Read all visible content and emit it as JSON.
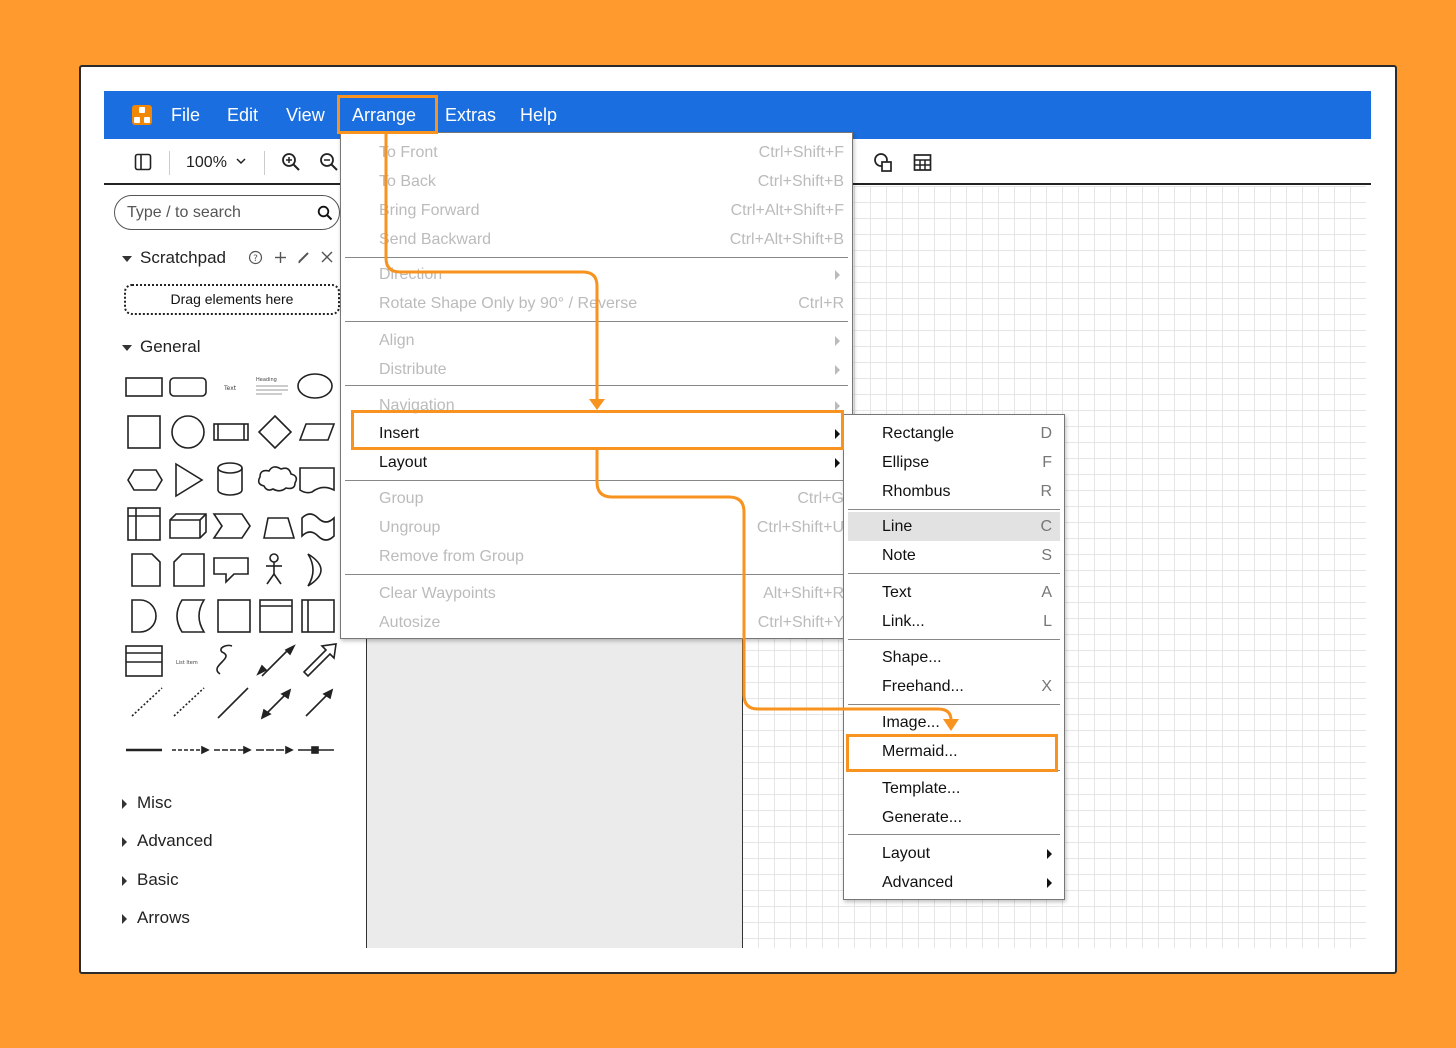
{
  "menubar": {
    "items": [
      "File",
      "Edit",
      "View",
      "Arrange",
      "Extras",
      "Help"
    ]
  },
  "toolbar": {
    "zoom": "100%"
  },
  "sidebar": {
    "search_placeholder": "Type / to search",
    "scratchpad": {
      "title": "Scratchpad",
      "dropzone": "Drag elements here"
    },
    "general": {
      "title": "General"
    },
    "collapsed_sections": [
      "Misc",
      "Advanced",
      "Basic",
      "Arrows"
    ]
  },
  "arrange_menu": {
    "items": [
      {
        "label": "To Front",
        "shortcut": "Ctrl+Shift+F"
      },
      {
        "label": "To Back",
        "shortcut": "Ctrl+Shift+B"
      },
      {
        "label": "Bring Forward",
        "shortcut": "Ctrl+Alt+Shift+F"
      },
      {
        "label": "Send Backward",
        "shortcut": "Ctrl+Alt+Shift+B"
      },
      {
        "label": "Direction",
        "shortcut": ""
      },
      {
        "label": "Rotate Shape Only by 90° / Reverse",
        "shortcut": "Ctrl+R"
      },
      {
        "label": "Align",
        "shortcut": ""
      },
      {
        "label": "Distribute",
        "shortcut": ""
      },
      {
        "label": "Navigation",
        "shortcut": ""
      },
      {
        "label": "Insert",
        "shortcut": ""
      },
      {
        "label": "Layout",
        "shortcut": ""
      },
      {
        "label": "Group",
        "shortcut": "Ctrl+G"
      },
      {
        "label": "Ungroup",
        "shortcut": "Ctrl+Shift+U"
      },
      {
        "label": "Remove from Group",
        "shortcut": ""
      },
      {
        "label": "Clear Waypoints",
        "shortcut": "Alt+Shift+R"
      },
      {
        "label": "Autosize",
        "shortcut": "Ctrl+Shift+Y"
      }
    ]
  },
  "insert_menu": {
    "items": [
      {
        "label": "Rectangle",
        "shortcut": "D"
      },
      {
        "label": "Ellipse",
        "shortcut": "F"
      },
      {
        "label": "Rhombus",
        "shortcut": "R"
      },
      {
        "label": "Line",
        "shortcut": "C"
      },
      {
        "label": "Note",
        "shortcut": "S"
      },
      {
        "label": "Text",
        "shortcut": "A"
      },
      {
        "label": "Link...",
        "shortcut": "L"
      },
      {
        "label": "Shape...",
        "shortcut": ""
      },
      {
        "label": "Freehand...",
        "shortcut": "X"
      },
      {
        "label": "Image...",
        "shortcut": ""
      },
      {
        "label": "Mermaid...",
        "shortcut": ""
      },
      {
        "label": "Template...",
        "shortcut": ""
      },
      {
        "label": "Generate...",
        "shortcut": ""
      },
      {
        "label": "Layout",
        "shortcut": ""
      },
      {
        "label": "Advanced",
        "shortcut": ""
      }
    ]
  },
  "colors": {
    "menubar": "#1A6EDF",
    "highlight": "#F7931E",
    "background": "#FF9A2E"
  }
}
